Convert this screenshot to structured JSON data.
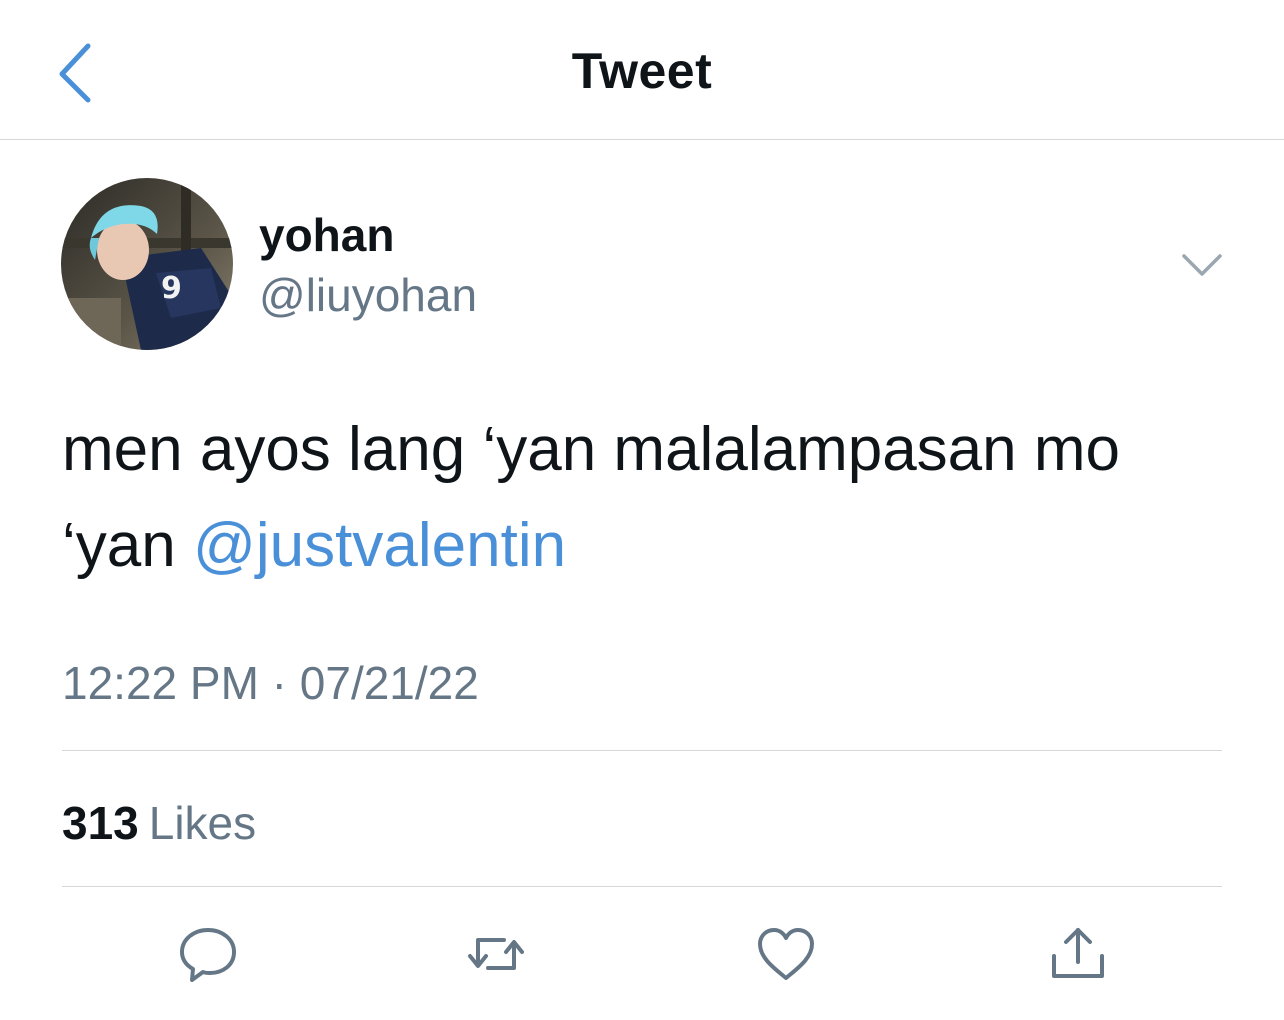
{
  "header": {
    "title": "Tweet",
    "back_icon": "chevron-left-icon",
    "accent": "#4a90d9"
  },
  "author": {
    "display_name": "yohan",
    "handle": "@liuyohan",
    "avatar_icon": "profile-photo"
  },
  "tweet": {
    "text_main": "men ayos lang ‘yan malalampasan mo ‘yan ",
    "mention": "@justvalentin",
    "timestamp": "12:22 PM · 07/21/22"
  },
  "stats": {
    "likes_count": "313",
    "likes_label": "Likes"
  },
  "actions": [
    {
      "name": "reply",
      "icon": "comment-icon"
    },
    {
      "name": "retweet",
      "icon": "retweet-icon"
    },
    {
      "name": "like",
      "icon": "heart-icon"
    },
    {
      "name": "share",
      "icon": "share-icon"
    }
  ],
  "colors": {
    "text": "#0f1419",
    "secondary": "#657786",
    "divider": "#d6d9dc",
    "link": "#4a90d9"
  }
}
